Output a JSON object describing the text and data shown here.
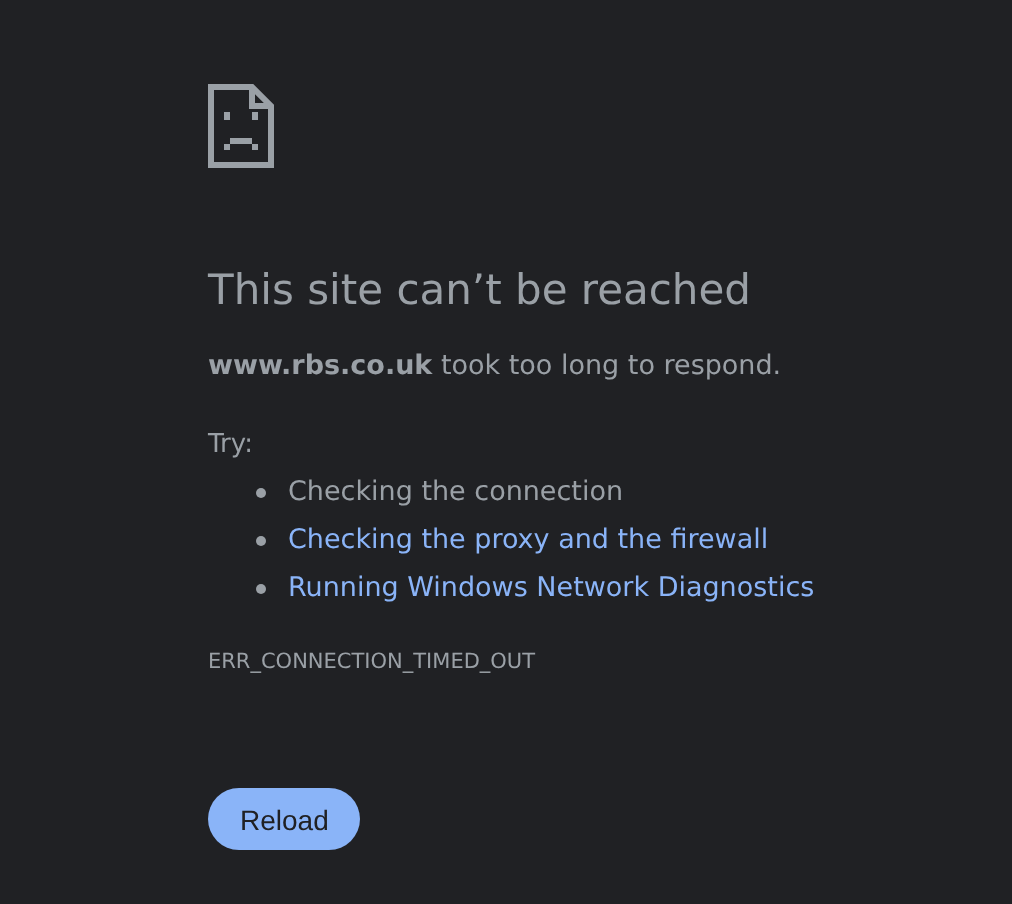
{
  "heading": "This site can’t be reached",
  "message": "**www.rbs.co.uk** took too long to respond.",
  "try_label": "Try:",
  "suggestions": [
    {
      "kind": "text",
      "text": "Checking the connection"
    },
    {
      "kind": "link",
      "text": "Checking the proxy and the firewall"
    },
    {
      "kind": "link",
      "text": "Running Windows Network Diagnostics"
    }
  ],
  "error_code": "ERR_CONNECTION_TIMED_OUT",
  "button": "Reload"
}
